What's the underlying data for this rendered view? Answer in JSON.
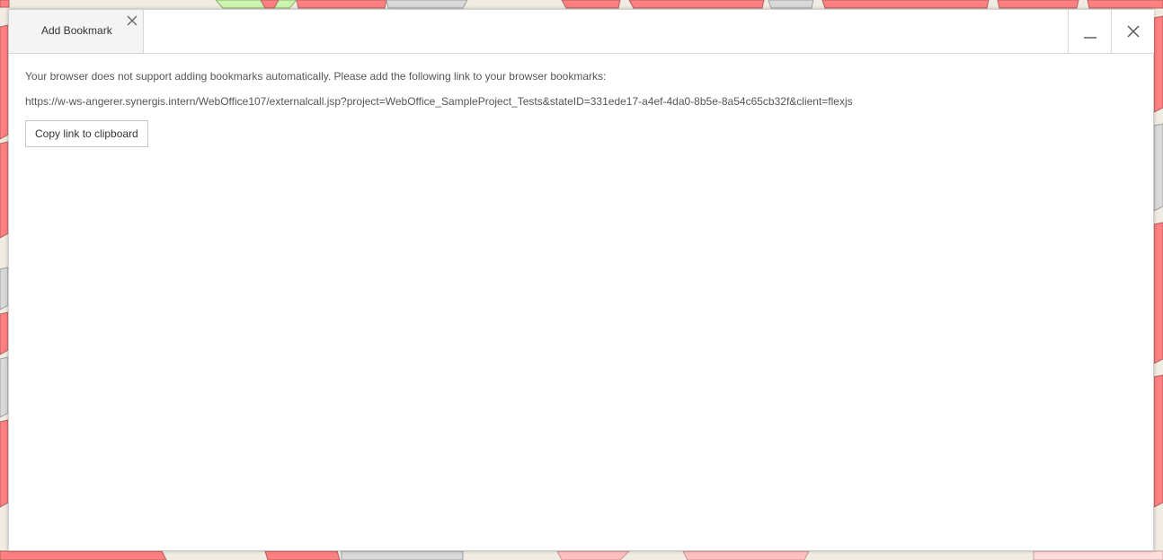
{
  "colors": {
    "map_background": "#f1ece3",
    "parcel_red": "#ff8080",
    "parcel_green": "#ccf5b0",
    "parcel_gray": "#d9d9d9",
    "dialog_background": "#ffffff",
    "text": "#555555"
  },
  "dialog": {
    "tabs": [
      {
        "label": "Add Bookmark",
        "close_icon": "close-icon"
      }
    ],
    "window_controls": {
      "minimize_icon": "minimize-icon",
      "close_icon": "close-icon"
    },
    "message": "Your browser does not support adding bookmarks automatically. Please add the following link to your browser bookmarks:",
    "link": "https://w-ws-angerer.synergis.intern/WebOffice107/externalcall.jsp?project=WebOffice_SampleProject_Tests&stateID=331ede17-a4ef-4da0-8b5e-8a54c65cb32f&client=flexjs",
    "copy_button_label": "Copy link to clipboard"
  }
}
